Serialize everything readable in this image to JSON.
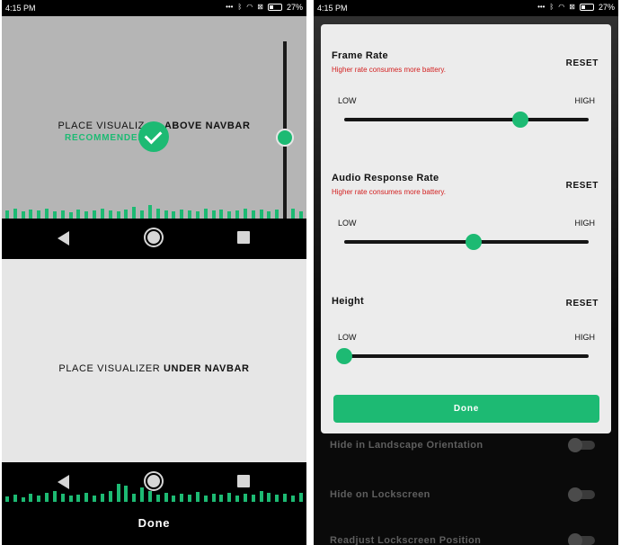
{
  "status_bar": {
    "time": "4:15 PM",
    "battery": "27%",
    "icons": [
      "more-dots-icon",
      "bluetooth-icon",
      "wifi-icon",
      "no-sim-icon",
      "battery-icon"
    ]
  },
  "left_screen": {
    "above_option": {
      "prefix": "PLACE VISUALIZ",
      "suffix": "ABOVE NAVBAR",
      "badge": "RECOMMENDED"
    },
    "under_option": {
      "prefix": "PLACE VISUALIZER ",
      "suffix": "UNDER NAVBAR"
    },
    "done_label": "Done",
    "slider_value": 0.5
  },
  "dialog": {
    "sections": [
      {
        "title": "Frame Rate",
        "subtitle": "Higher rate consumes more battery.",
        "reset": "RESET",
        "low": "LOW",
        "high": "HIGH",
        "value": 0.72
      },
      {
        "title": "Audio Response Rate",
        "subtitle": "Higher rate consumes more battery.",
        "reset": "RESET",
        "low": "LOW",
        "high": "HIGH",
        "value": 0.53
      },
      {
        "title": "Height",
        "subtitle": "",
        "reset": "RESET",
        "low": "LOW",
        "high": "HIGH",
        "value": 0.0
      }
    ],
    "done_label": "Done"
  },
  "background_settings": [
    {
      "label": "Hide in Landscape Orientation"
    },
    {
      "label": "Hide on Lockscreen"
    },
    {
      "label": "Readjust Lockscreen Position"
    }
  ],
  "colors": {
    "accent": "#1dba73",
    "warning": "#d32020"
  }
}
